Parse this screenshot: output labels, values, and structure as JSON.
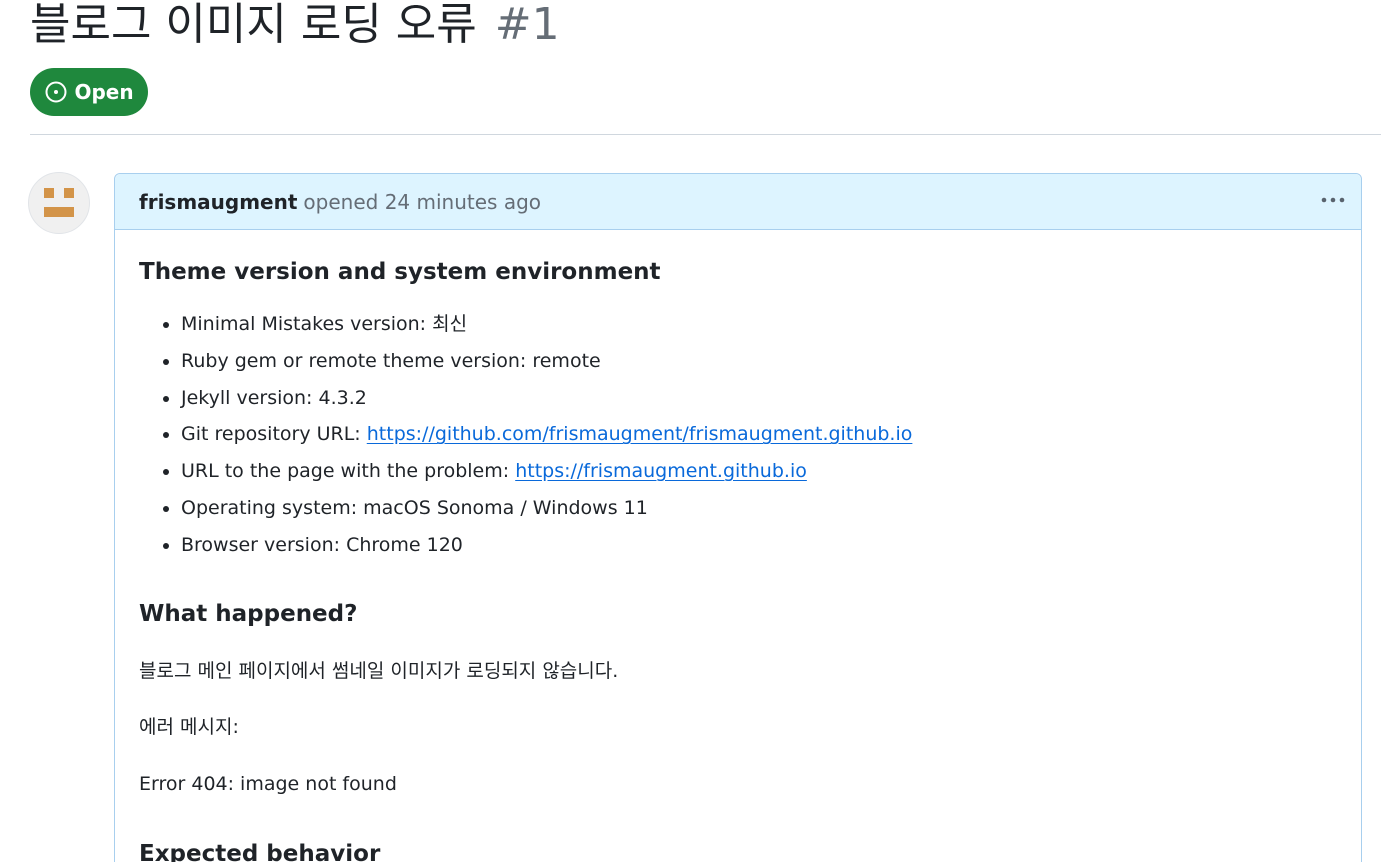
{
  "issue": {
    "title": "블로그 이미지 로딩 오류",
    "number": "#1",
    "state_label": "Open",
    "state_icon": "issue-opened-icon",
    "state_color": "#1f883d"
  },
  "comment": {
    "author": "frismaugment",
    "opened_text": "opened 24 minutes ago",
    "menu_icon": "kebab-horizontal-icon",
    "header_color": "#ddf4ff",
    "sections": {
      "env_heading": "Theme version and system environment",
      "env_items": [
        {
          "label": "Minimal Mistakes version: 최신",
          "link": ""
        },
        {
          "label": "Ruby gem or remote theme version: remote",
          "link": ""
        },
        {
          "label": "Jekyll version: 4.3.2",
          "link": ""
        },
        {
          "label": "Git repository URL: ",
          "link": "https://github.com/frismaugment/frismaugment.github.io"
        },
        {
          "label": "URL to the page with the problem: ",
          "link": "https://frismaugment.github.io"
        },
        {
          "label": "Operating system: macOS Sonoma / Windows 11",
          "link": ""
        },
        {
          "label": "Browser version: Chrome 120",
          "link": ""
        }
      ],
      "happened_heading": "What happened?",
      "happened_text": "블로그 메인 페이지에서 썸네일 이미지가 로딩되지 않습니다.",
      "error_label": "에러 메시지:",
      "error_text": "Error 404: image not found",
      "expected_heading": "Expected behavior"
    }
  }
}
